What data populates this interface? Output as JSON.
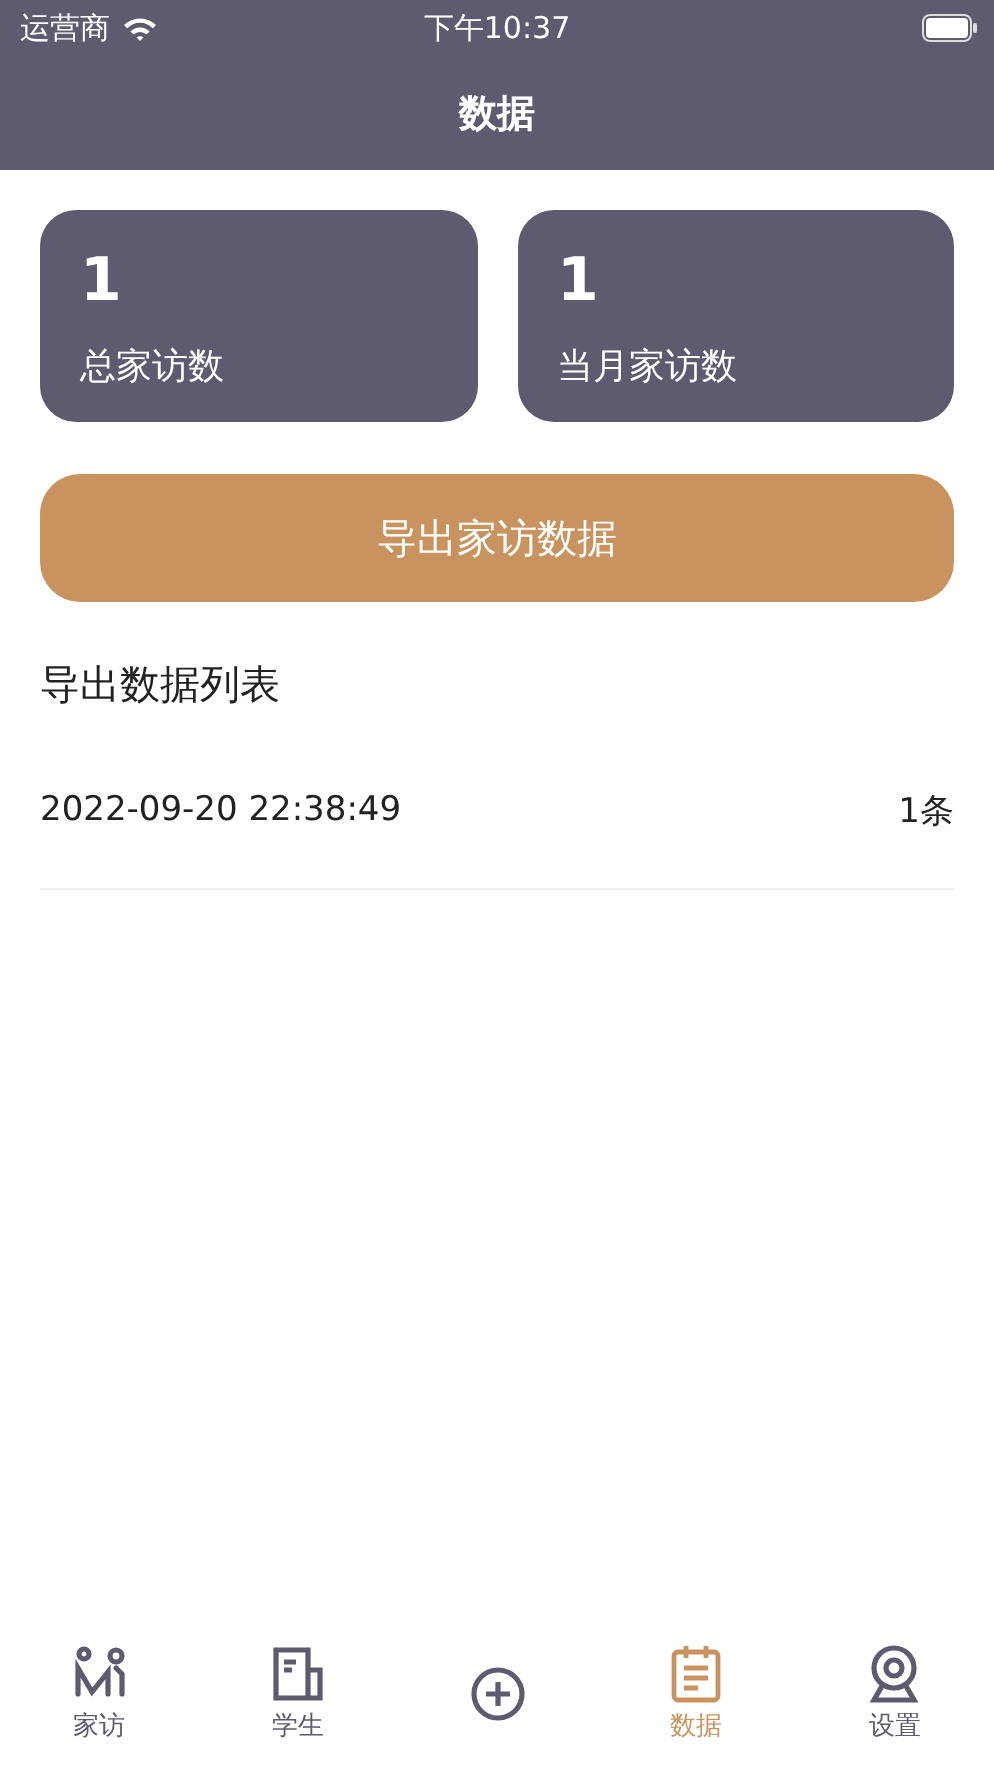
{
  "status_bar": {
    "carrier": "运营商",
    "time": "下午10:37"
  },
  "nav": {
    "title": "数据"
  },
  "stats": [
    {
      "value": "1",
      "label": "总家访数"
    },
    {
      "value": "1",
      "label": "当月家访数"
    }
  ],
  "export_button": "导出家访数据",
  "list_title": "导出数据列表",
  "exports": [
    {
      "time": "2022-09-20 22:38:49",
      "count": "1条"
    }
  ],
  "tabs": [
    {
      "kind": "visit",
      "label": "家访",
      "selected": false
    },
    {
      "kind": "student",
      "label": "学生",
      "selected": false
    },
    {
      "kind": "add",
      "selected": false
    },
    {
      "kind": "data",
      "label": "数据",
      "selected": true
    },
    {
      "kind": "settings",
      "label": "设置",
      "selected": false
    }
  ]
}
